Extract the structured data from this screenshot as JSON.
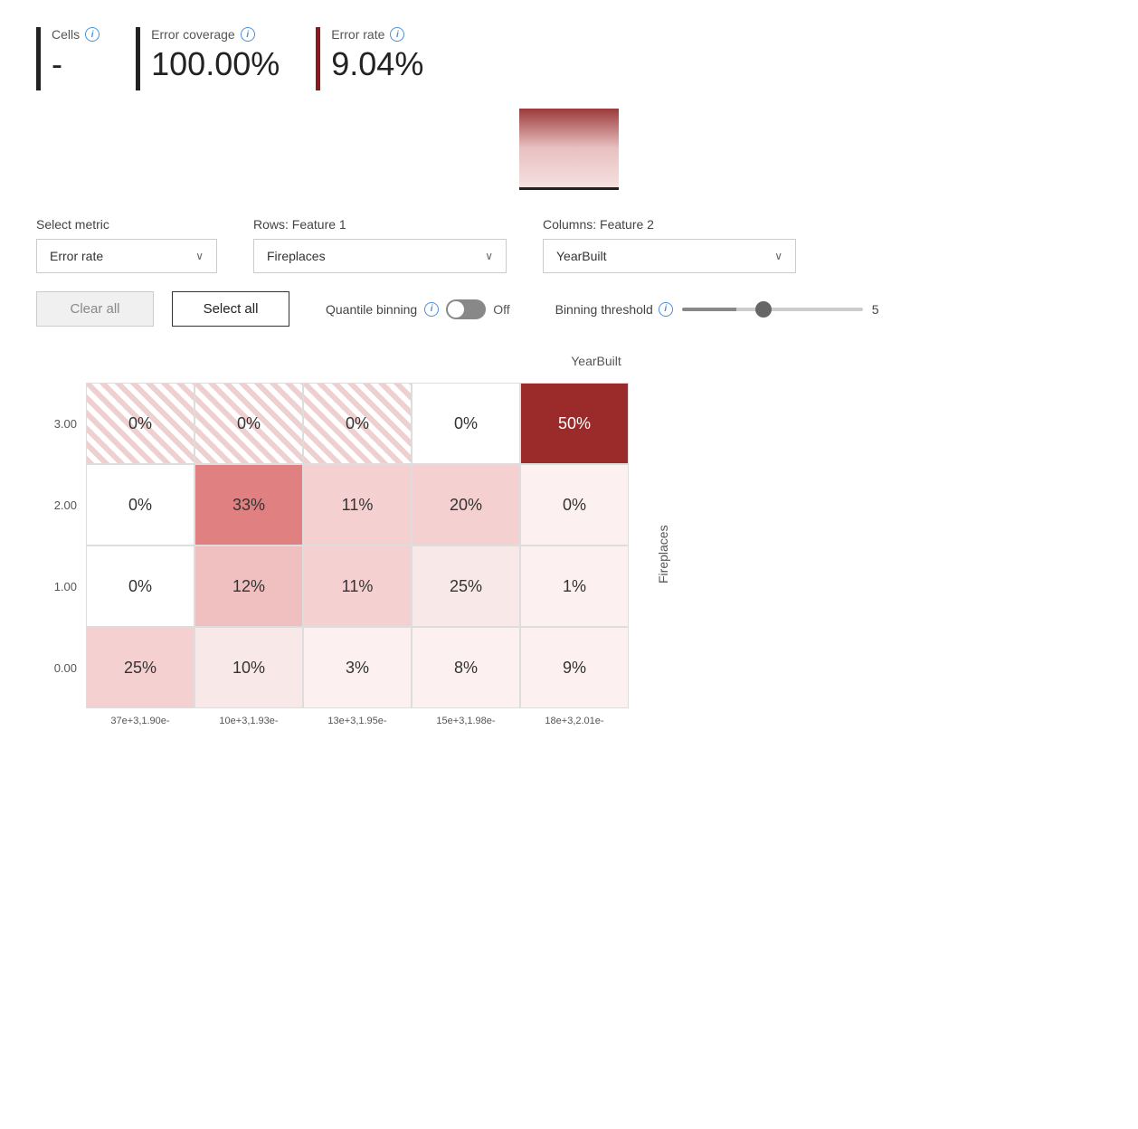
{
  "metrics": {
    "cells": {
      "label": "Cells",
      "value": "-",
      "bar_color": "dark"
    },
    "error_coverage": {
      "label": "Error coverage",
      "value": "100.00%",
      "bar_color": "dark"
    },
    "error_rate": {
      "label": "Error rate",
      "value": "9.04%",
      "bar_color": "red"
    }
  },
  "controls": {
    "select_metric_label": "Select metric",
    "select_metric_value": "Error rate",
    "rows_label": "Rows: Feature 1",
    "rows_value": "Fireplaces",
    "columns_label": "Columns: Feature 2",
    "columns_value": "YearBuilt",
    "clear_all_label": "Clear all",
    "select_all_label": "Select all",
    "quantile_label": "Quantile binning",
    "quantile_state": "Off",
    "binning_threshold_label": "Binning threshold",
    "binning_threshold_value": "5"
  },
  "matrix": {
    "column_axis_label": "YearBuilt",
    "row_axis_label": "Fireplaces",
    "row_labels": [
      "3.00",
      "2.00",
      "1.00",
      "0.00"
    ],
    "x_axis_labels": [
      "37e+3,1.90e-",
      "10e+3,1.93e-",
      "13e+3,1.95e-",
      "15e+3,1.98e-",
      "18e+3,2.01e-"
    ],
    "cells": [
      [
        "0%",
        "0%",
        "0%",
        "0%",
        "50%"
      ],
      [
        "0%",
        "33%",
        "11%",
        "20%",
        "0%"
      ],
      [
        "0%",
        "12%",
        "11%",
        "25%",
        "1%"
      ],
      [
        "25%",
        "10%",
        "3%",
        "8%",
        "9%"
      ]
    ],
    "cell_styles": [
      [
        "hatched",
        "hatched",
        "hatched",
        "white",
        "deep-red"
      ],
      [
        "white",
        "medium-pink",
        "light-medium-pink",
        "light-medium-pink",
        "very-light-pink"
      ],
      [
        "white",
        "pink",
        "light-medium-pink",
        "light-pink",
        "very-light-pink"
      ],
      [
        "light-medium-pink",
        "light-pink",
        "very-light-pink",
        "very-light-pink",
        "very-light-pink"
      ]
    ]
  },
  "icons": {
    "info": "i",
    "chevron_down": "∨"
  }
}
